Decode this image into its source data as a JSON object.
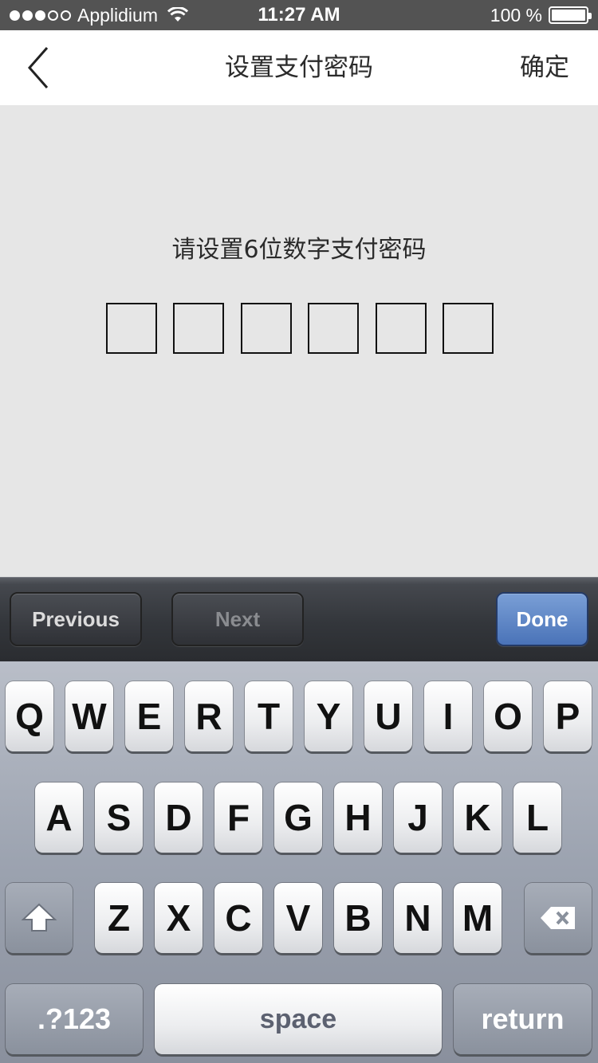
{
  "status_bar": {
    "carrier": "Applidium",
    "time": "11:27 AM",
    "battery": "100 %"
  },
  "nav": {
    "title": "设置支付密码",
    "confirm_label": "确定"
  },
  "content": {
    "prompt": "请设置6位数字支付密码",
    "pin_length": 6
  },
  "toolbar": {
    "previous_label": "Previous",
    "next_label": "Next",
    "done_label": "Done"
  },
  "keyboard": {
    "row1": [
      "Q",
      "W",
      "E",
      "R",
      "T",
      "Y",
      "U",
      "I",
      "O",
      "P"
    ],
    "row2": [
      "A",
      "S",
      "D",
      "F",
      "G",
      "H",
      "J",
      "K",
      "L"
    ],
    "row3": [
      "Z",
      "X",
      "C",
      "V",
      "B",
      "N",
      "M"
    ],
    "numbers_label": ".?123",
    "space_label": "space",
    "return_label": "return"
  },
  "colors": {
    "background": "#e6e6e6",
    "status_bar": "#535353",
    "done_button": "#5b82c4"
  }
}
